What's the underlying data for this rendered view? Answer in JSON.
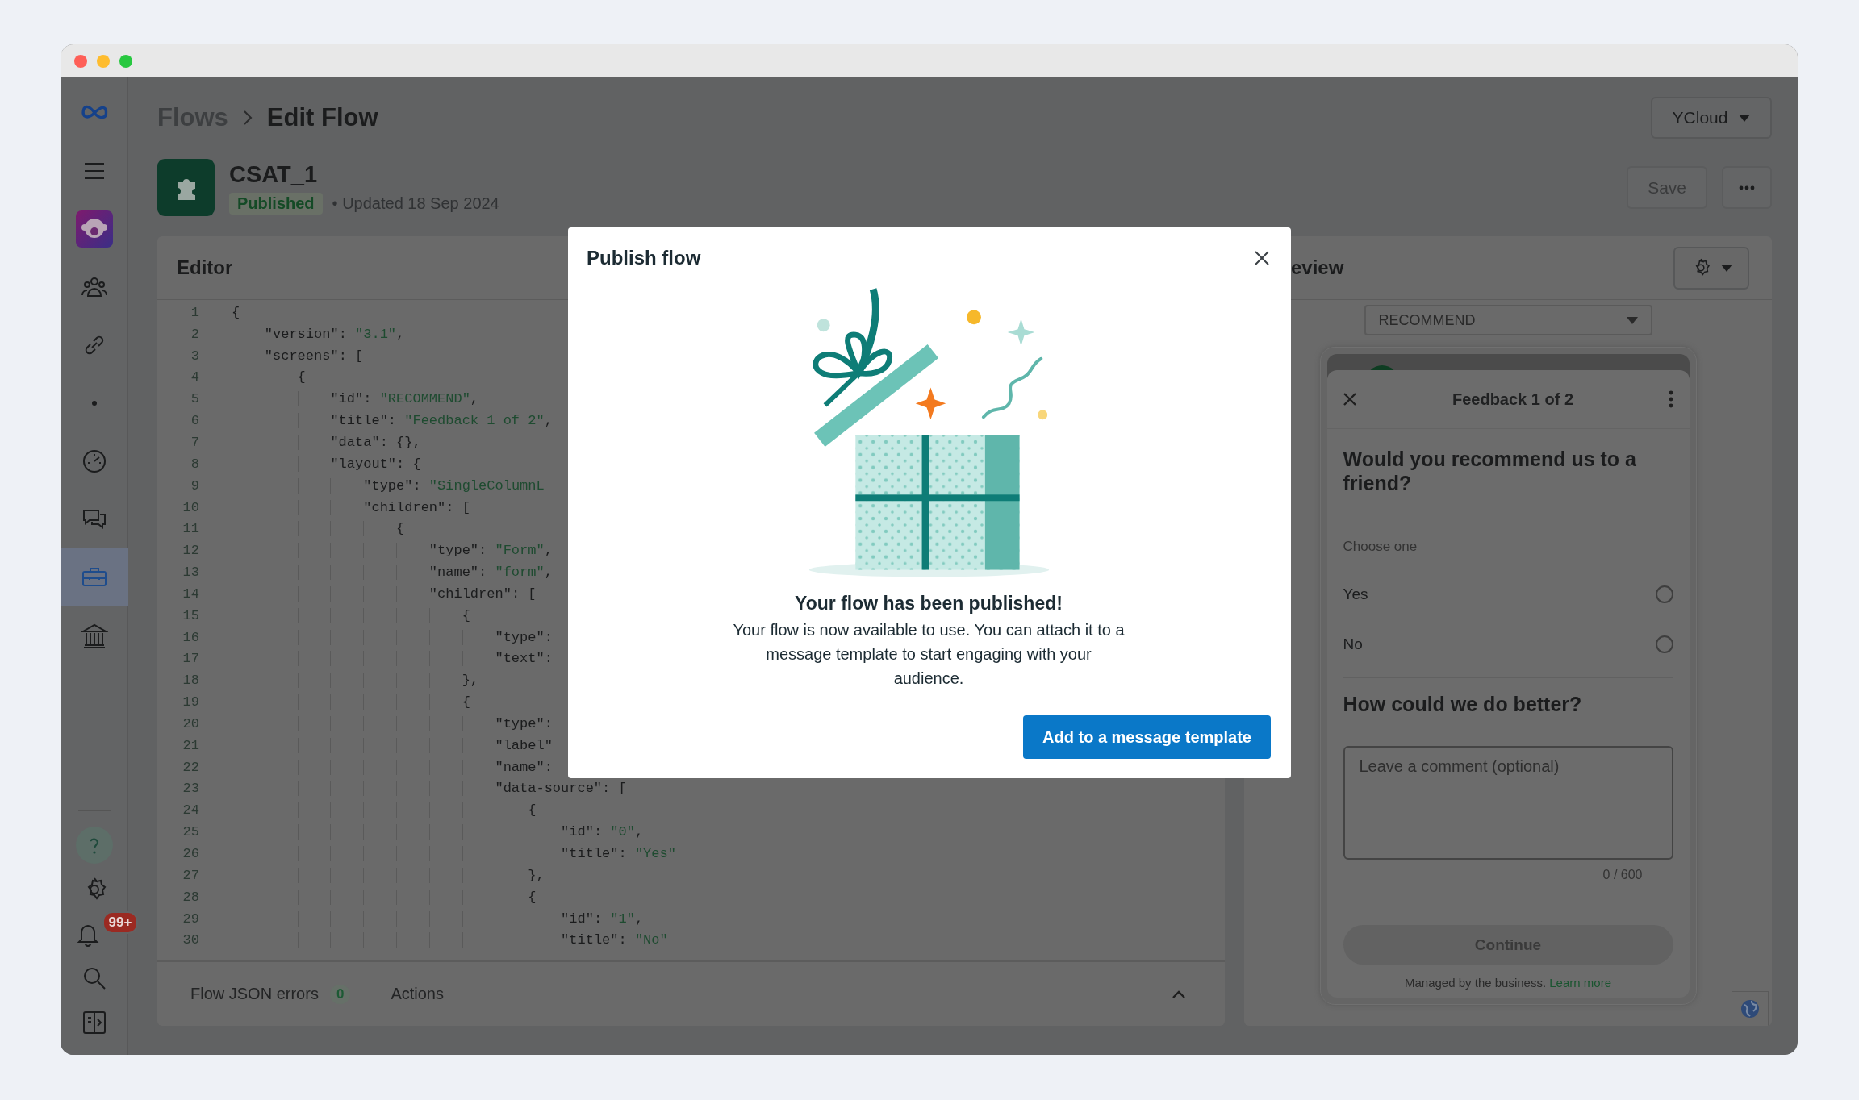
{
  "sidebar": {
    "top_items": [
      {
        "kind": "logo",
        "selected": false
      },
      {
        "kind": "menu",
        "selected": false
      },
      {
        "kind": "app",
        "selected": false
      },
      {
        "kind": "people",
        "selected": false
      },
      {
        "kind": "link",
        "selected": false
      },
      {
        "kind": "dot",
        "selected": false
      },
      {
        "kind": "dashboard",
        "selected": false
      },
      {
        "kind": "chat",
        "selected": false
      },
      {
        "kind": "toolbox",
        "selected": true
      },
      {
        "kind": "bank",
        "selected": false
      }
    ],
    "bottom_items": [
      {
        "kind": "help",
        "selected": false
      },
      {
        "kind": "settings",
        "selected": false
      },
      {
        "kind": "bell",
        "selected": false,
        "badge": "99+"
      },
      {
        "kind": "search",
        "selected": false
      },
      {
        "kind": "panel",
        "selected": false
      }
    ]
  },
  "header": {
    "breadcrumb": [
      "Flows",
      "Edit Flow"
    ],
    "account_menu": "YCloud"
  },
  "flow": {
    "name": "CSAT_1",
    "status": "Published",
    "updated": "• Updated 18 Sep 2024",
    "save_button": "Save"
  },
  "editor": {
    "title": "Editor",
    "lines": [
      {
        "number": "1",
        "text": "{"
      },
      {
        "number": "2",
        "text": "    \"version\": \"3.1\","
      },
      {
        "number": "3",
        "text": "    \"screens\": ["
      },
      {
        "number": "4",
        "text": "        {"
      },
      {
        "number": "5",
        "text": "            \"id\": \"RECOMMEND\","
      },
      {
        "number": "6",
        "text": "            \"title\": \"Feedback 1 of 2\","
      },
      {
        "number": "7",
        "text": "            \"data\": {},"
      },
      {
        "number": "8",
        "text": "            \"layout\": {"
      },
      {
        "number": "9",
        "text": "                \"type\": \"SingleColumnL"
      },
      {
        "number": "10",
        "text": "                \"children\": ["
      },
      {
        "number": "11",
        "text": "                    {"
      },
      {
        "number": "12",
        "text": "                        \"type\": \"Form\","
      },
      {
        "number": "13",
        "text": "                        \"name\": \"form\","
      },
      {
        "number": "14",
        "text": "                        \"children\": ["
      },
      {
        "number": "15",
        "text": "                            {"
      },
      {
        "number": "16",
        "text": "                                \"type\":"
      },
      {
        "number": "17",
        "text": "                                \"text\":"
      },
      {
        "number": "18",
        "text": "                            },"
      },
      {
        "number": "19",
        "text": "                            {"
      },
      {
        "number": "20",
        "text": "                                \"type\":"
      },
      {
        "number": "21",
        "text": "                                \"label\""
      },
      {
        "number": "22",
        "text": "                                \"name\":"
      },
      {
        "number": "23",
        "text": "                                \"data-source\": ["
      },
      {
        "number": "24",
        "text": "                                    {"
      },
      {
        "number": "25",
        "text": "                                        \"id\": \"0\","
      },
      {
        "number": "26",
        "text": "                                        \"title\": \"Yes\""
      },
      {
        "number": "27",
        "text": "                                    },"
      },
      {
        "number": "28",
        "text": "                                    {"
      },
      {
        "number": "29",
        "text": "                                        \"id\": \"1\","
      },
      {
        "number": "30",
        "text": "                                        \"title\": \"No\""
      }
    ],
    "footer": {
      "errors_label": "Flow JSON errors",
      "errors_count": "0",
      "actions": "Actions"
    }
  },
  "preview": {
    "title": "eview",
    "screen_select": "RECOMMEND",
    "phone": {
      "title": "Feedback 1 of 2",
      "question": "Would you recommend us to a friend?",
      "choose_label": "Choose one",
      "options": [
        {
          "label": "Yes",
          "selected": false
        },
        {
          "label": "No",
          "selected": false
        }
      ],
      "comment_heading": "How could we do better?",
      "comment_placeholder": "Leave a comment (optional)",
      "counter": "0 / 600",
      "continue": {
        "label": "Continue",
        "disabled": true
      },
      "managed_text": "Managed by the business.",
      "learn_more": "Learn more"
    }
  },
  "modal": {
    "title": "Publish flow",
    "heading": "Your flow has been published!",
    "body": "Your flow is now available to use. You can attach it to a message template to start engaging with your audience.",
    "button": "Add to a message template"
  }
}
